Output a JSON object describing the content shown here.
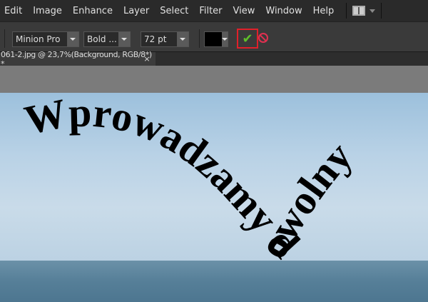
{
  "menu": [
    "Edit",
    "Image",
    "Enhance",
    "Layer",
    "Select",
    "Filter",
    "View",
    "Window",
    "Help"
  ],
  "options": {
    "font": "Minion Pro",
    "style": "Bold ...",
    "size": "72 pt",
    "color": "#000000"
  },
  "doc_tab": {
    "title": "061-2.jpg @ 23,7%(Background, RGB/8*) *",
    "close": "×"
  },
  "canvas_text": "Wprowadzamy dowolny",
  "commit_icon": "✔"
}
